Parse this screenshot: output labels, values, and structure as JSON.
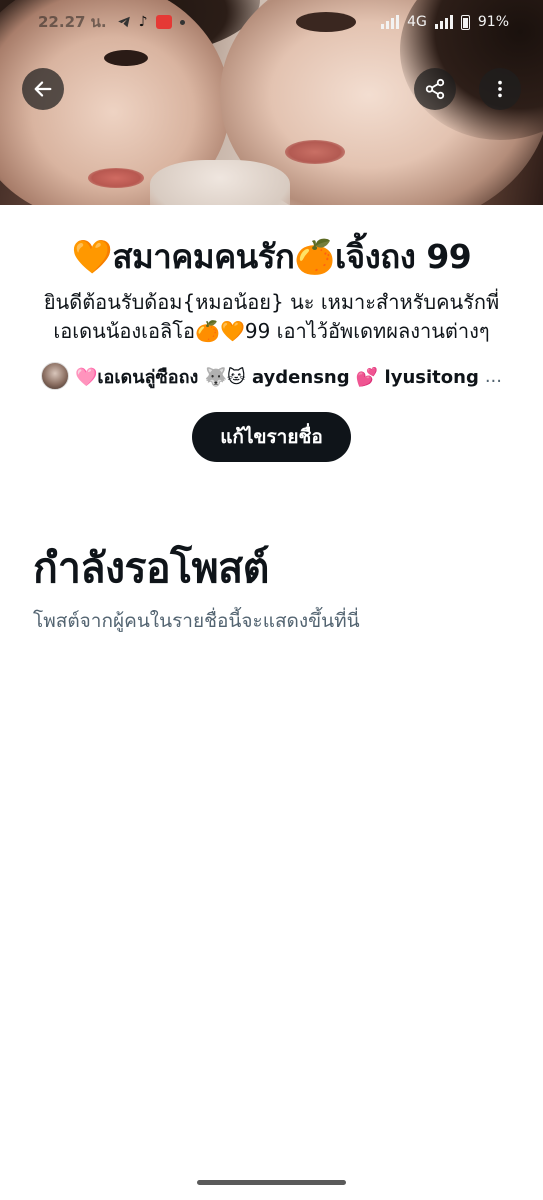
{
  "status_bar": {
    "time": "22.27 น.",
    "network": "4G",
    "battery": "91%"
  },
  "banner": {
    "back_icon": "arrow-left-icon",
    "share_icon": "share-icon",
    "more_icon": "more-vertical-icon"
  },
  "list": {
    "title": "🧡สมาคมคนรัก🍊เจิ้งถง 99",
    "description_line1": "ยินดีต้อนรับด้อม{หมอน้อย} นะ เหมาะสำหรับคนรักพี่",
    "description_line2": "เอเดนน้องเอลิโอ🍊🧡99 เอาไว้อัพเดทผลงานต่างๆ",
    "members_text": "🩷เอเดนลู่ซือถง 🐺🐱 aydensng 💕 lyusitong",
    "members_ellipsis": "...",
    "edit_button": "แก้ไขรายชื่อ"
  },
  "empty_state": {
    "title": "กำลังรอโพสต์",
    "subtitle": "โพสต์จากผู้คนในรายชื่อนี้จะแสดงขึ้นที่นี่"
  },
  "colors": {
    "primary_text": "#0f1419",
    "secondary_text": "#536471",
    "button_bg": "#0f1419"
  }
}
